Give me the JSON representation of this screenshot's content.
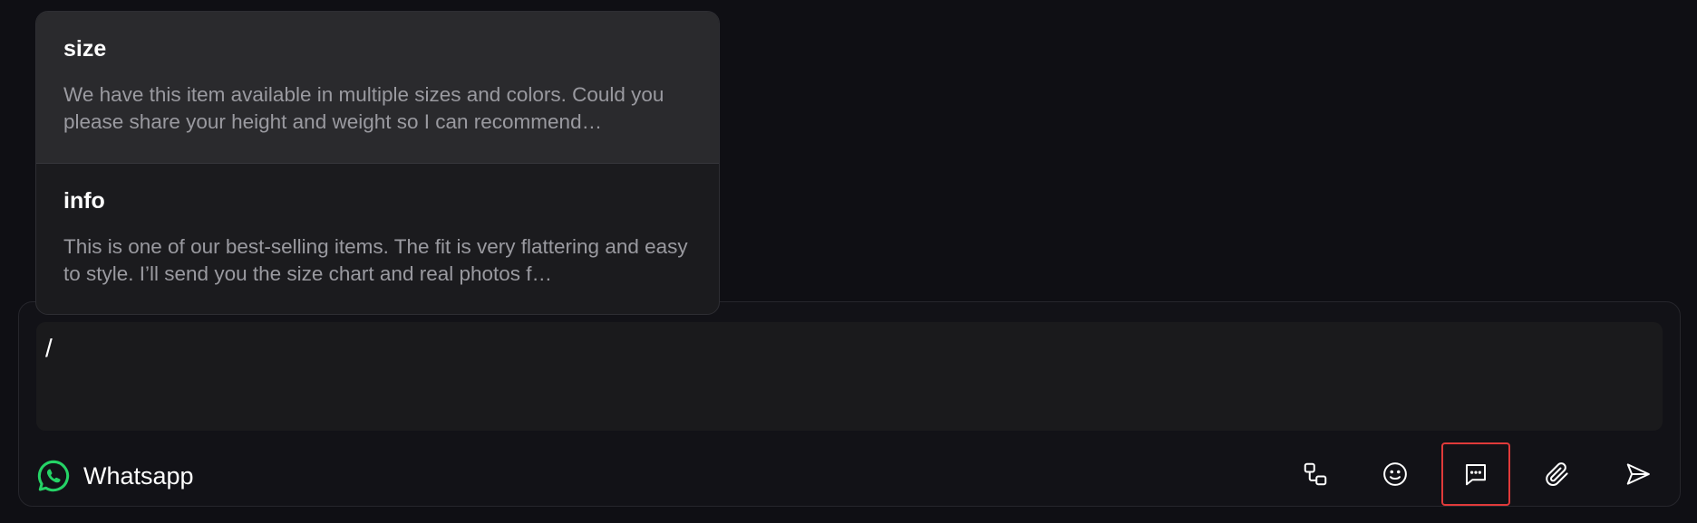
{
  "quick_replies": [
    {
      "title": "size",
      "body": "We have this item available in multiple sizes and colors. Could you please share your height and weight so I can recommend…"
    },
    {
      "title": "info",
      "body": "This is one of our best-selling items. The fit is very flattering and easy to style. I’ll send you the size chart and real photos f…"
    }
  ],
  "composer": {
    "value": "/",
    "channel_label": "Whatsapp",
    "channel_icon": "whatsapp-icon",
    "tools": [
      "integration-icon",
      "emoji-icon",
      "quick-reply-icon",
      "attachment-icon",
      "send-icon"
    ]
  },
  "colors": {
    "background": "#0f0f14",
    "whatsapp_green": "#25d366",
    "highlight_border": "#e03a3a"
  }
}
